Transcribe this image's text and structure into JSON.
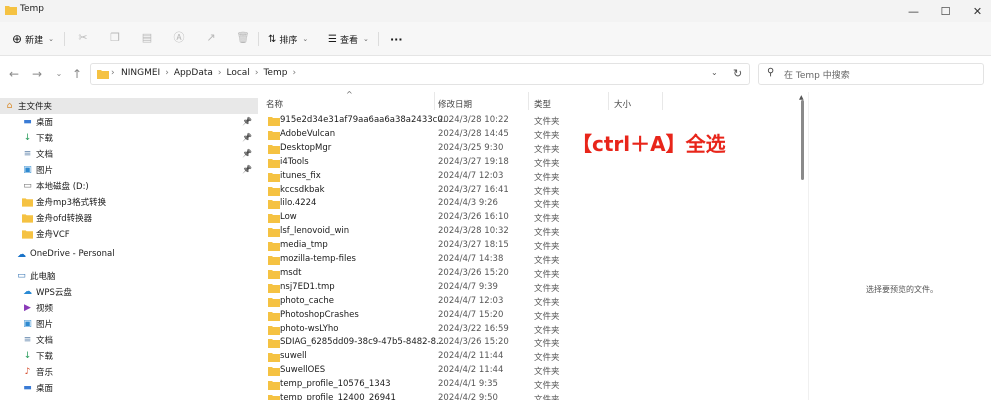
{
  "window": {
    "title": "Temp",
    "minimize": "—",
    "maximize": "☐",
    "close": "✕"
  },
  "toolbar": {
    "new_label": "新建",
    "sort_label": "排序",
    "view_label": "查看",
    "more_label": "···"
  },
  "address": {
    "crumbs": [
      "NINGMEI",
      "AppData",
      "Local",
      "Temp"
    ],
    "separator": "›",
    "search_placeholder": "在 Temp 中搜索"
  },
  "sidebar": {
    "items": [
      {
        "label": "主文件夹",
        "icon": "home-icon",
        "pinned": false
      },
      {
        "label": "桌面",
        "icon": "desktop-icon",
        "pinned": true
      },
      {
        "label": "下载",
        "icon": "download-icon",
        "pinned": true
      },
      {
        "label": "文档",
        "icon": "document-icon",
        "pinned": true
      },
      {
        "label": "图片",
        "icon": "picture-icon",
        "pinned": true
      },
      {
        "label": "本地磁盘 (D:)",
        "icon": "drive-icon",
        "pinned": false
      },
      {
        "label": "金舟mp3格式转换",
        "icon": "folder-icon",
        "pinned": false
      },
      {
        "label": "金舟ofd转换器",
        "icon": "folder-icon",
        "pinned": false
      },
      {
        "label": "金舟VCF",
        "icon": "folder-icon",
        "pinned": false
      },
      {
        "label": "OneDrive - Personal",
        "icon": "cloud-icon",
        "pinned": false
      },
      {
        "label": "此电脑",
        "icon": "computer-icon",
        "pinned": false
      },
      {
        "label": "WPS云盘",
        "icon": "cloud-drive-icon",
        "pinned": false
      },
      {
        "label": "视频",
        "icon": "video-icon",
        "pinned": false
      },
      {
        "label": "图片",
        "icon": "picture-icon",
        "pinned": false
      },
      {
        "label": "文档",
        "icon": "document-icon",
        "pinned": false
      },
      {
        "label": "下载",
        "icon": "download-icon",
        "pinned": false
      },
      {
        "label": "音乐",
        "icon": "music-icon",
        "pinned": false
      },
      {
        "label": "桌面",
        "icon": "desktop-icon",
        "pinned": false
      }
    ]
  },
  "columns": {
    "name": "名称",
    "modified": "修改日期",
    "type": "类型",
    "size": "大小"
  },
  "files": [
    {
      "name": "915e2d34e31af79aa6aa6a38a2433c0...",
      "date": "2024/3/28 10:22",
      "type": "文件夹"
    },
    {
      "name": "AdobeVulcan",
      "date": "2024/3/28 14:45",
      "type": "文件夹"
    },
    {
      "name": "DesktopMgr",
      "date": "2024/3/25 9:30",
      "type": "文件夹"
    },
    {
      "name": "i4Tools",
      "date": "2024/3/27 19:18",
      "type": "文件夹"
    },
    {
      "name": "itunes_fix",
      "date": "2024/4/7 12:03",
      "type": "文件夹"
    },
    {
      "name": "kccsdkbak",
      "date": "2024/3/27 16:41",
      "type": "文件夹"
    },
    {
      "name": "lilo.4224",
      "date": "2024/4/3 9:26",
      "type": "文件夹"
    },
    {
      "name": "Low",
      "date": "2024/3/26 16:10",
      "type": "文件夹"
    },
    {
      "name": "lsf_lenovoid_win",
      "date": "2024/3/28 10:32",
      "type": "文件夹"
    },
    {
      "name": "media_tmp",
      "date": "2024/3/27 18:15",
      "type": "文件夹"
    },
    {
      "name": "mozilla-temp-files",
      "date": "2024/4/7 14:38",
      "type": "文件夹"
    },
    {
      "name": "msdt",
      "date": "2024/3/26 15:20",
      "type": "文件夹"
    },
    {
      "name": "nsj7ED1.tmp",
      "date": "2024/4/7 9:39",
      "type": "文件夹"
    },
    {
      "name": "photo_cache",
      "date": "2024/4/7 12:03",
      "type": "文件夹"
    },
    {
      "name": "PhotoshopCrashes",
      "date": "2024/4/7 15:20",
      "type": "文件夹"
    },
    {
      "name": "photo-wsLYho",
      "date": "2024/3/22 16:59",
      "type": "文件夹"
    },
    {
      "name": "SDIAG_6285dd09-38c9-47b5-8482-8...",
      "date": "2024/3/26 15:20",
      "type": "文件夹"
    },
    {
      "name": "suwell",
      "date": "2024/4/2 11:44",
      "type": "文件夹"
    },
    {
      "name": "SuwellOES",
      "date": "2024/4/2 11:44",
      "type": "文件夹"
    },
    {
      "name": "temp_profile_10576_1343",
      "date": "2024/4/1 9:35",
      "type": "文件夹"
    },
    {
      "name": "temp_profile_12400_26941",
      "date": "2024/4/2 9:50",
      "type": "文件夹"
    }
  ],
  "annotation": "【ctrl＋A】全选",
  "preview": {
    "empty_text": "选择要预览的文件。"
  },
  "colors": {
    "folder": "#f5c242",
    "annotation": "#e8251a"
  }
}
